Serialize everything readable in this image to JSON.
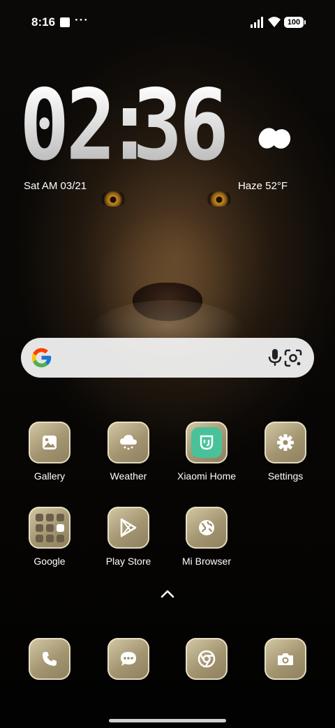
{
  "status_bar": {
    "time": "8:16",
    "more_indicator": "···",
    "battery_level": "100",
    "icons": [
      "notification-square-icon",
      "signal-icon",
      "wifi-icon",
      "battery-icon"
    ]
  },
  "clock_widget": {
    "hours": "02",
    "separator": ":",
    "minutes": "36",
    "date": "Sat AM 03/21",
    "weather": "Haze  52°F",
    "weather_icon": "haze-icon"
  },
  "search_bar": {
    "icons": [
      "google-logo-icon",
      "microphone-icon",
      "google-lens-icon"
    ]
  },
  "apps": [
    {
      "label": "Gallery",
      "icon": "gallery-icon"
    },
    {
      "label": "Weather",
      "icon": "weather-cloud-icon"
    },
    {
      "label": "Xiaomi Home",
      "icon": "xiaomi-home-icon"
    },
    {
      "label": "Settings",
      "icon": "gear-icon"
    },
    {
      "label": "Google",
      "icon": "folder-icon"
    },
    {
      "label": "Play Store",
      "icon": "play-store-icon"
    },
    {
      "label": "Mi Browser",
      "icon": "globe-icon"
    }
  ],
  "dock": [
    {
      "icon": "phone-icon"
    },
    {
      "icon": "messages-icon"
    },
    {
      "icon": "chrome-icon"
    },
    {
      "icon": "camera-icon"
    }
  ],
  "colors": {
    "icon_gold": "#a49571",
    "icon_highlight": "#d4c9a6",
    "mi_home_green": "#49c29a",
    "search_bar_bg": "#eeeeee"
  }
}
